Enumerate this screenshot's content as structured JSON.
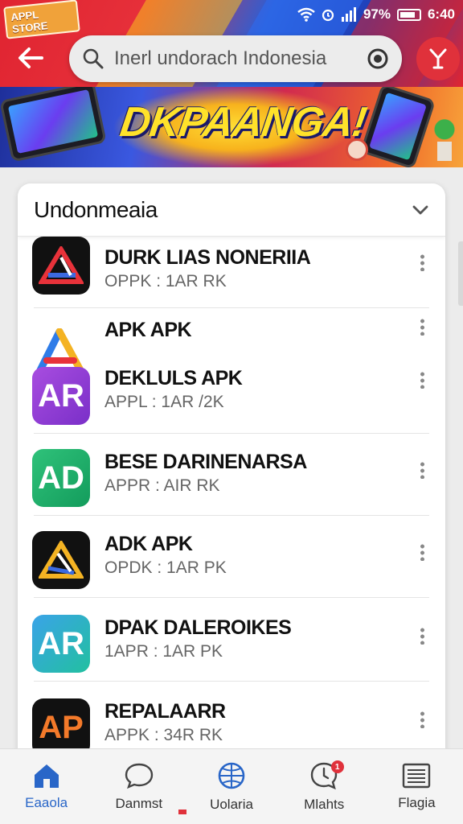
{
  "header": {
    "brand_label": "APPL STORE",
    "status": {
      "signal_text": "97%",
      "time": "6:40"
    },
    "search": {
      "value": "Inerl undorach Indonesia"
    }
  },
  "banner": {
    "title": "DKPAANGA!"
  },
  "section": {
    "title": "Undonmeaia"
  },
  "apps": [
    {
      "name": "DURK LIAS NONERIIA",
      "meta": "OPPK : 1AR RK",
      "icon_text": "",
      "icon_name": "triangle-logo-icon"
    },
    {
      "name": "APK APK",
      "meta": "",
      "icon_text": "",
      "icon_name": "rainbow-a-logo-icon"
    },
    {
      "name": "DEKLULS APK",
      "meta": "APPL : 1AR /2K",
      "icon_text": "AR",
      "icon_name": "purple-ar-logo-icon"
    },
    {
      "name": "BESE DARINENARSA",
      "meta": "APPR : AIR RK",
      "icon_text": "AD",
      "icon_name": "green-ad-logo-icon"
    },
    {
      "name": "ADK APK",
      "meta": "OPDK : 1AR PK",
      "icon_text": "",
      "icon_name": "dark-triangle-logo-icon"
    },
    {
      "name": "DPAK DALEROIKES",
      "meta": "1APR : 1AR PK",
      "icon_text": "AR",
      "icon_name": "teal-ar-logo-icon"
    },
    {
      "name": "REPALAARR",
      "meta": "APPK : 34R RK",
      "icon_text": "AP",
      "icon_name": "black-ap-logo-icon"
    }
  ],
  "bottom_nav": [
    {
      "label": "Eaaola",
      "icon": "home-icon"
    },
    {
      "label": "Danmst",
      "icon": "chat-bubble-icon"
    },
    {
      "label": "Uolaria",
      "icon": "globe-icon"
    },
    {
      "label": "Mlahts",
      "icon": "clock-bubble-icon",
      "badge": "1"
    },
    {
      "label": "Flagia",
      "icon": "newspaper-icon"
    }
  ],
  "colors": {
    "accent_red": "#e0313b",
    "accent_blue": "#2966c8"
  }
}
